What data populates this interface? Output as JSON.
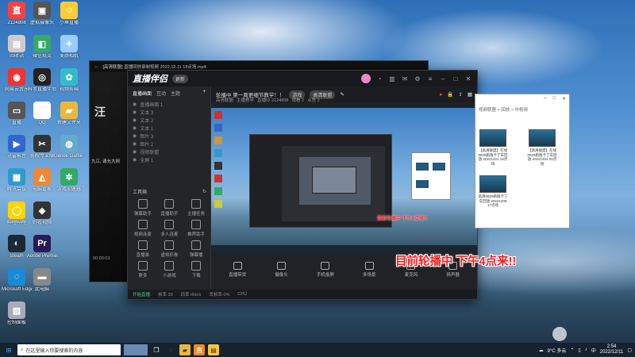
{
  "desktop": {
    "icons": [
      {
        "label": "2124808",
        "glyph": "直"
      },
      {
        "label": "虚拟摄像头",
        "glyph": "▣"
      },
      {
        "label": "小鱼直播",
        "glyph": "☺"
      },
      {
        "label": "回收站",
        "glyph": "▤"
      },
      {
        "label": "微信精灵",
        "glyph": "◧"
      },
      {
        "label": "美颜相机",
        "glyph": "✦"
      },
      {
        "label": "网易云音乐",
        "glyph": "◉"
      },
      {
        "label": "抖音直播伴侣",
        "glyph": "◎"
      },
      {
        "label": "视频剪辑",
        "glyph": "✿"
      },
      {
        "label": "直播",
        "glyph": "▭"
      },
      {
        "label": "QQ",
        "glyph": "◕"
      },
      {
        "label": "新建文件夹",
        "glyph": "▰"
      },
      {
        "label": "迅雷影音",
        "glyph": "▶"
      },
      {
        "label": "剪映专业版",
        "glyph": "✂"
      },
      {
        "label": "Genee Game Studio",
        "glyph": "◍"
      },
      {
        "label": "腾讯会议",
        "glyph": "▦"
      },
      {
        "label": "电脑管家",
        "glyph": "◭"
      },
      {
        "label": "游戏加速器",
        "glyph": "✲"
      },
      {
        "label": "哔哩哔哩",
        "glyph": "◯"
      },
      {
        "label": "好看视频",
        "glyph": "◈"
      },
      {
        "label": "Steam",
        "glyph": "◐"
      },
      {
        "label": "Adobe Premiere Pro",
        "glyph": "Pr"
      },
      {
        "label": "Microsoft Edge",
        "glyph": "◌"
      },
      {
        "label": "此电脑",
        "glyph": "▬"
      },
      {
        "label": "控制面板",
        "glyph": "▧"
      }
    ]
  },
  "bg_window": {
    "title": "[高清联盟] 直播回放录制视频 2022.12.11 18点场.mp4",
    "chat_line": "九江, 请允大网",
    "time": "00:00:03"
  },
  "main_window": {
    "logo": "直播伴侣",
    "badge": "更新",
    "side_tabs": [
      "直播画面",
      "互动",
      "主题"
    ],
    "scene_items": [
      "直播画面 1",
      "文本 3",
      "文本 2",
      "文本 1",
      "图片 3",
      "图片 2",
      "视频联盟",
      "全屏 1"
    ],
    "tools_title": "工具箱",
    "tools": [
      {
        "label": "弹幕助手"
      },
      {
        "label": "直播助手"
      },
      {
        "label": "主播任务"
      },
      {
        "label": "视频连麦"
      },
      {
        "label": "多人连麦"
      },
      {
        "label": "推荐助手"
      },
      {
        "label": "直播录"
      },
      {
        "label": "虚拟形象"
      },
      {
        "label": "弹幕播"
      },
      {
        "label": "更多"
      },
      {
        "label": "小游戏"
      },
      {
        "label": "下载"
      }
    ],
    "stream_title": "轮播中 第一周更细节教学！！",
    "stream_tag": "游戏",
    "stream_category": "高清联盟",
    "stream_meta": [
      "高清联盟",
      "主播教学",
      "直播ID 2124808",
      "观看 2",
      "点赞 2"
    ],
    "bottom_buttons": [
      "直播带货",
      "摄像头",
      "手机投屏",
      "多场景",
      "麦克风",
      "扬声器"
    ],
    "status_items": [
      "开始直播",
      "帧率 30",
      "码率 0kb/s",
      "丢帧率 0%",
      "CPU"
    ],
    "preview_overlay": "目前轮播中 下午4点来!!"
  },
  "explorer": {
    "path": "视频联盟 > 回放 > 中视频",
    "files": [
      {
        "label": "【高清联盟】在线0829跑跑卡丁车回放 20221201 18点场"
      },
      {
        "label": "【高清联盟】在线0829跑跑卡丁车回放 20221204 00点场"
      },
      {
        "label": "高清0829跑跑卡丁车回放 20221208 17点场"
      }
    ]
  },
  "overlay_text": "目前轮播中 下午4点来!!",
  "taskbar": {
    "search_placeholder": "在这里输入你要搜索的内容",
    "weather": "9°C 多云",
    "time": "2:54",
    "date": "2022/12/11"
  }
}
